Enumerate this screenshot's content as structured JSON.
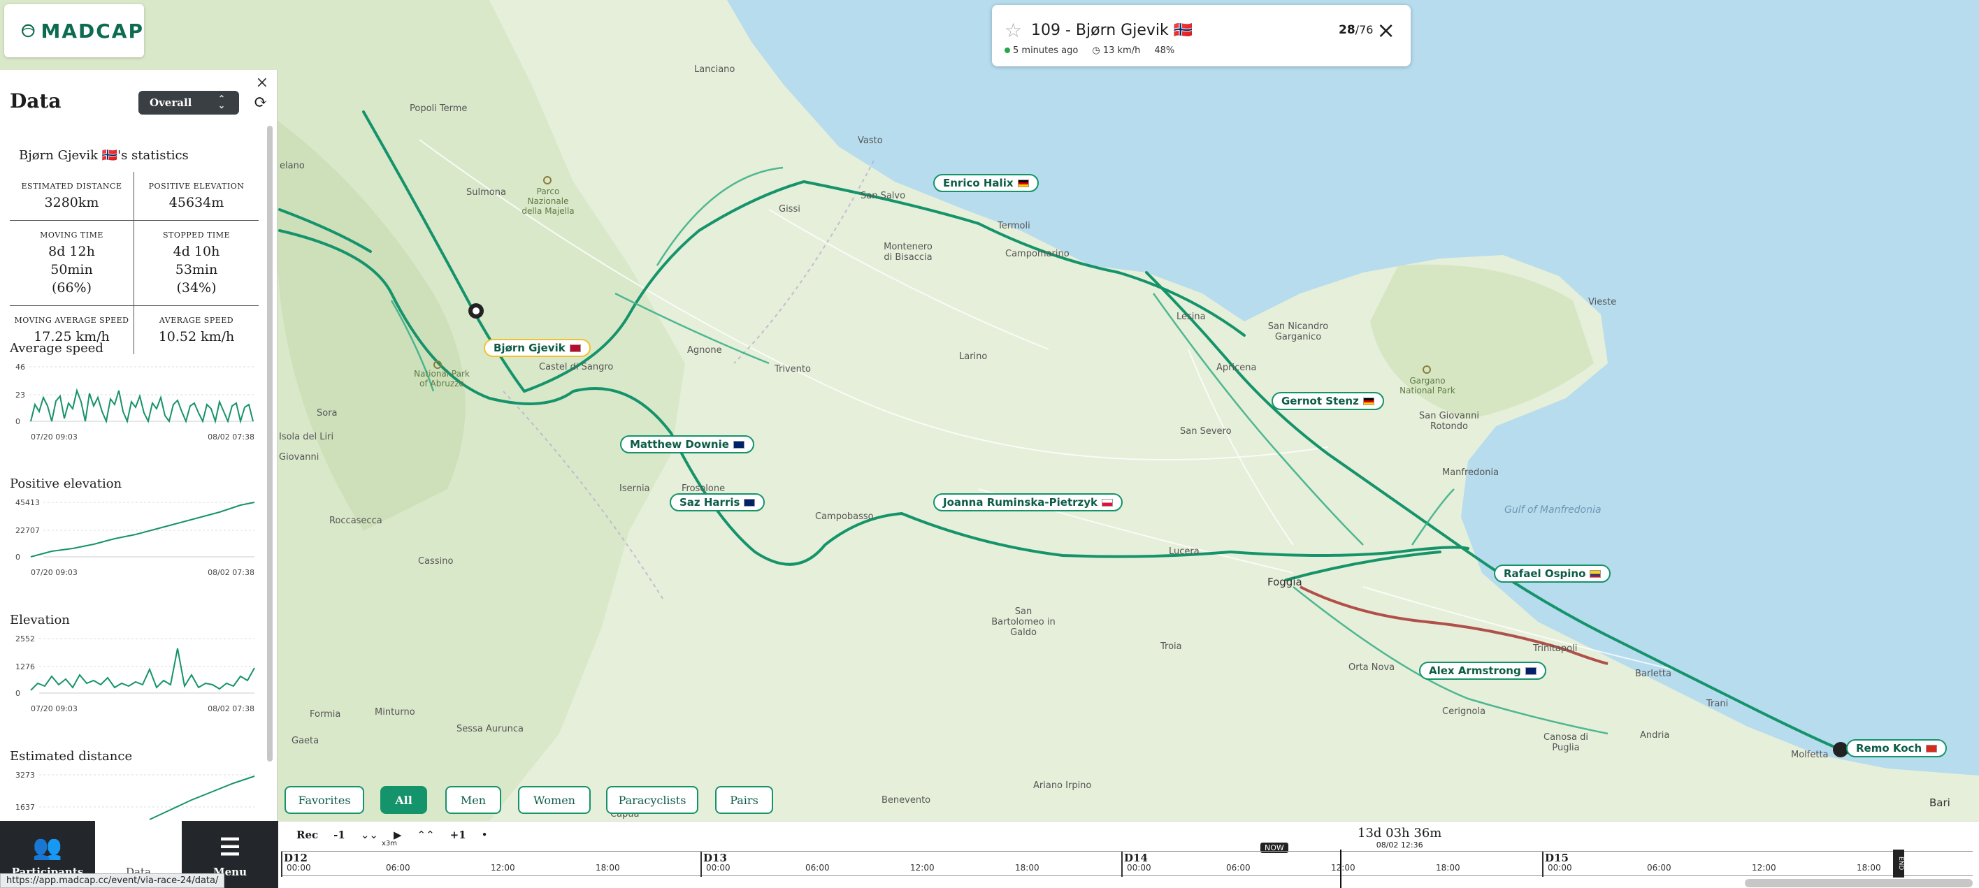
{
  "logo": {
    "text": "MADCAP"
  },
  "panel": {
    "title": "Data",
    "select_value": "Overall",
    "stats_title": "Bjørn Gjevik 🇳🇴's statistics",
    "stats": [
      {
        "label": "ESTIMATED DISTANCE",
        "value": "3280km"
      },
      {
        "label": "POSITIVE ELEVATION",
        "value": "45634m"
      },
      {
        "label": "MOVING TIME",
        "value": "8d 12h 50min (66%)"
      },
      {
        "label": "STOPPED TIME",
        "value": "4d 10h 53min (34%)"
      },
      {
        "label": "MOVING AVERAGE SPEED",
        "value": "17.25 km/h"
      },
      {
        "label": "AVERAGE SPEED",
        "value": "10.52 km/h"
      }
    ],
    "charts": [
      {
        "title": "Average speed",
        "y_ticks": [
          "46",
          "23",
          "0"
        ],
        "x_start": "07/20 09:03",
        "x_end": "08/02 07:38"
      },
      {
        "title": "Positive elevation",
        "y_ticks": [
          "45413",
          "22707",
          "0"
        ],
        "x_start": "07/20 09:03",
        "x_end": "08/02 07:38"
      },
      {
        "title": "Elevation",
        "y_ticks": [
          "2552",
          "1276",
          "0"
        ],
        "x_start": "07/20 09:03",
        "x_end": "08/02 07:38"
      },
      {
        "title": "Estimated distance",
        "y_ticks": [
          "3273",
          "1637"
        ],
        "x_start": "",
        "x_end": ""
      }
    ]
  },
  "card": {
    "title": "109 - Bjørn Gjevik 🇳🇴",
    "rank_current": "28",
    "rank_total": "/76",
    "last_seen": "5 minutes ago",
    "speed": "13 km/h",
    "progress": "48%"
  },
  "riders": [
    {
      "name": "Enrico Halix",
      "flag": "de"
    },
    {
      "name": "Bjørn Gjevik",
      "flag": "no"
    },
    {
      "name": "Matthew Downie",
      "flag": "gb"
    },
    {
      "name": "Saz Harris",
      "flag": "gb"
    },
    {
      "name": "Joanna Ruminska-Pietrzyk",
      "flag": "pl"
    },
    {
      "name": "Gernot Stenz",
      "flag": "de"
    },
    {
      "name": "Rafael Ospino",
      "flag": "co"
    },
    {
      "name": "Alex Armstrong",
      "flag": "gb"
    },
    {
      "name": "Remo Koch",
      "flag": "ch"
    }
  ],
  "places": {
    "popoli": "Popoli Terme",
    "lanciano": "Lanciano",
    "vasto": "Vasto",
    "sulmona": "Sulmona",
    "majella": "Parco Nazionale della Majella",
    "san_salvo": "San Salvo",
    "termoli": "Termoli",
    "gissi": "Gissi",
    "montenero": "Montenero di Bisaccia",
    "campomarino": "Campomarino",
    "lesina": "Lesina",
    "vieste": "Vieste",
    "san_nicandro": "San Nicandro Garganico",
    "gargano": "Gargano National Park",
    "agnone": "Agnone",
    "castel": "Castel di Sangro",
    "trivento": "Trivento",
    "larino": "Larino",
    "apricena": "Apricena",
    "abruzzo": "National Park of Abruzzo",
    "sora": "Sora",
    "isola": "Isola del Liri",
    "san_giovanni": "San Giovanni Rotondo",
    "san_severo": "San Severo",
    "manfredonia": "Manfredonia",
    "gulf": "Gulf of Manfredonia",
    "giovanni": "Giovanni",
    "isernia": "Isernia",
    "frosolone": "Frosolone",
    "campobasso": "Campobasso",
    "lucera": "Lucera",
    "foggia": "Foggia",
    "roccasecca": "Roccasecca",
    "cassino": "Cassino",
    "san_bartolomeo": "San Bartolomeo in Galdo",
    "troia": "Troia",
    "trinitapoli": "Trinitapoli",
    "orta_nova": "Orta Nova",
    "barletta": "Barletta",
    "trani": "Trani",
    "cerignola": "Cerignola",
    "canosa": "Canosa di Puglia",
    "andria": "Andria",
    "molfetta": "Molfetta",
    "formia": "Formia",
    "minturno": "Minturno",
    "sessa": "Sessa Aurunca",
    "gaeta": "Gaeta",
    "benevento": "Benevento",
    "ariano": "Ariano Irpino",
    "bari": "Bari",
    "elano": "elano",
    "capua": "Capua"
  },
  "filters": [
    "Favorites",
    "All",
    "Men",
    "Women",
    "Paracyclists",
    "Pairs"
  ],
  "bottom_nav": {
    "participants": "Participants",
    "data": "Data",
    "menu": "Menu"
  },
  "status_url": "https://app.madcap.cc/event/via-race-24/data/",
  "timeline": {
    "rec": "Rec",
    "minus": "-1",
    "plus": "+1",
    "speed": "x3m",
    "clock_main": "13d 03h 36m",
    "clock_sub": "08/02 12:36",
    "now": "NOW",
    "end": "END",
    "days": [
      "D12",
      "D13",
      "D14",
      "D15"
    ],
    "hours": [
      "00:00",
      "06:00",
      "12:00",
      "18:00"
    ]
  },
  "colors": {
    "route": "#15936b",
    "route_light": "#3db08a",
    "route_red": "#b0504a",
    "land": "#e6efd9",
    "sea": "#b6dcee",
    "accent": "#15936b"
  }
}
